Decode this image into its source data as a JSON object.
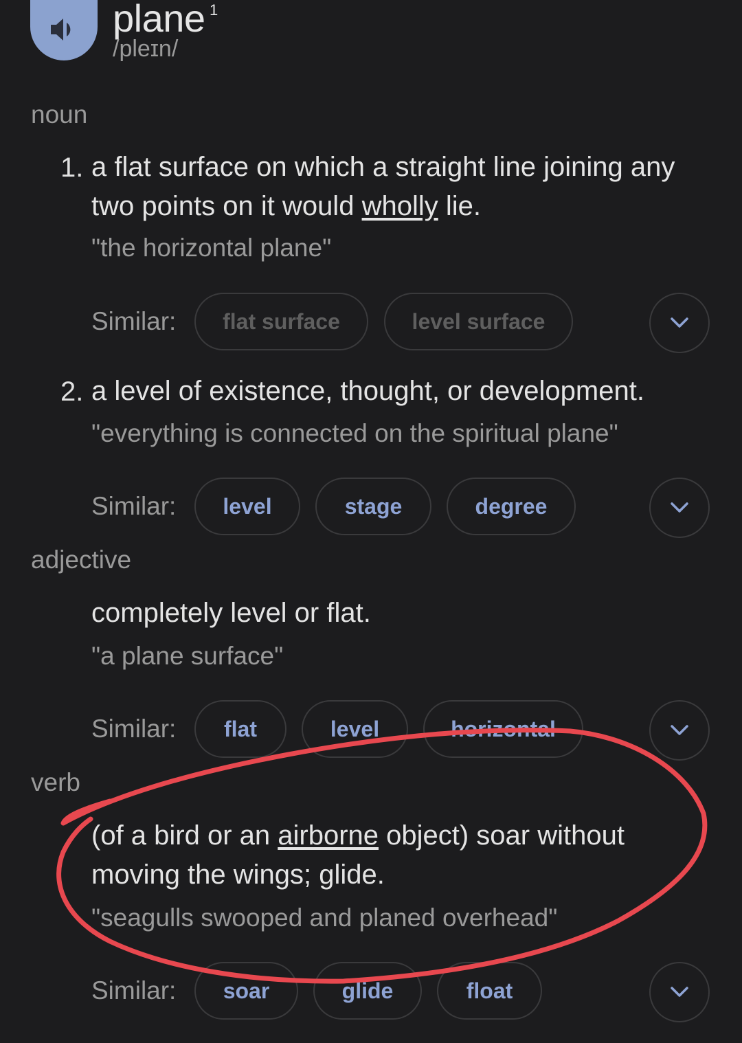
{
  "header": {
    "word": "plane",
    "superscript": "1",
    "phonetic": "/pleɪn/"
  },
  "noun": {
    "label": "noun",
    "senses": [
      {
        "number": "1.",
        "definition_pre": "a flat surface on which a straight line joining any two points on it would ",
        "definition_link": "wholly",
        "definition_post": " lie.",
        "example": "\"the horizontal plane\"",
        "similar_label": "Similar:",
        "similar": [
          "flat surface",
          "level surface"
        ]
      },
      {
        "number": "2.",
        "definition": "a level of existence, thought, or development.",
        "example": "\"everything is connected on the spiritual plane\"",
        "similar_label": "Similar:",
        "similar": [
          "level",
          "stage",
          "degree"
        ]
      }
    ]
  },
  "adjective": {
    "label": "adjective",
    "definition": "completely level or flat.",
    "example": "\"a plane surface\"",
    "similar_label": "Similar:",
    "similar": [
      "flat",
      "level",
      "horizontal"
    ]
  },
  "verb": {
    "label": "verb",
    "definition_pre": "(of a bird or an ",
    "definition_link": "airborne",
    "definition_post": " object) soar without moving the wings; glide.",
    "example": "\"seagulls swooped and planed overhead\"",
    "similar_label": "Similar:",
    "similar": [
      "soar",
      "glide",
      "float"
    ]
  },
  "colors": {
    "background": "#1c1c1e",
    "speaker": "#8ba2cf",
    "chip_text": "#8ea3d4",
    "annotation": "#e8484f"
  },
  "icons": {
    "speaker": "speaker-icon",
    "expand": "chevron-down-icon"
  }
}
